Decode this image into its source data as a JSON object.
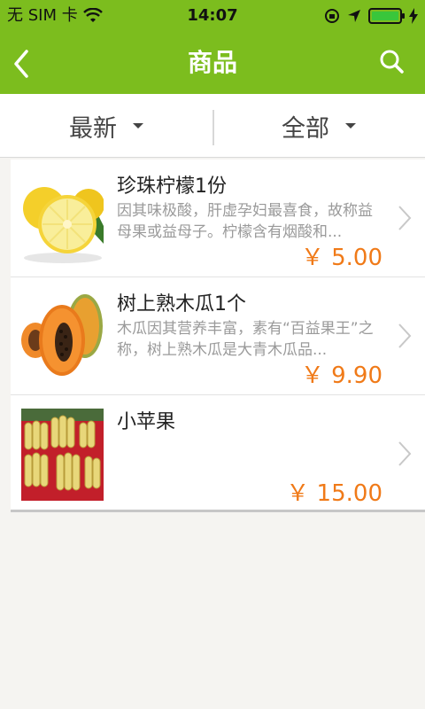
{
  "status": {
    "carrier": "无 SIM 卡",
    "time": "14:07"
  },
  "nav": {
    "title": "商品",
    "back_icon": "back-chevron-icon",
    "search_icon": "search-icon"
  },
  "filters": {
    "sort_label": "最新",
    "category_label": "全部"
  },
  "products": [
    {
      "title": "珍珠柠檬1份",
      "desc": "因其味极酸，肝虚孕妇最喜食，故称益母果或益母子。柠檬含有烟酸和...",
      "price": "￥ 5.00"
    },
    {
      "title": "树上熟木瓜1个",
      "desc": "木瓜因其营养丰富，素有“百益果王”之称，树上熟木瓜是大青木瓜品...",
      "price": "￥ 9.90"
    },
    {
      "title": "小苹果",
      "desc": "",
      "price": "￥ 15.00"
    }
  ],
  "colors": {
    "accent": "#7cbd1e",
    "price": "#f07a18"
  }
}
